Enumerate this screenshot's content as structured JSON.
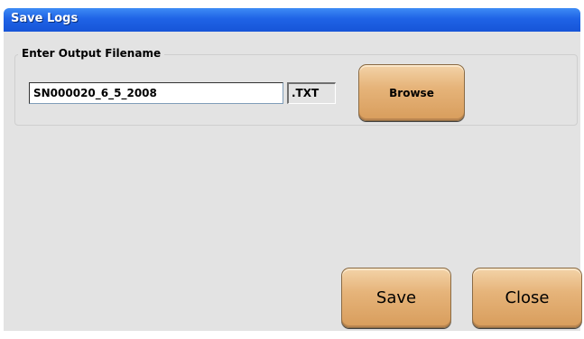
{
  "window": {
    "title": "Save Logs"
  },
  "group": {
    "label": "Enter Output Filename",
    "filename_value": "SN000020_6_5_2008",
    "extension": ".TXT"
  },
  "buttons": {
    "browse": "Browse",
    "save": "Save",
    "close": "Close"
  },
  "colors": {
    "titlebar": "#1f63e6",
    "background": "#e3e3e3",
    "button": "#e6b47a"
  }
}
